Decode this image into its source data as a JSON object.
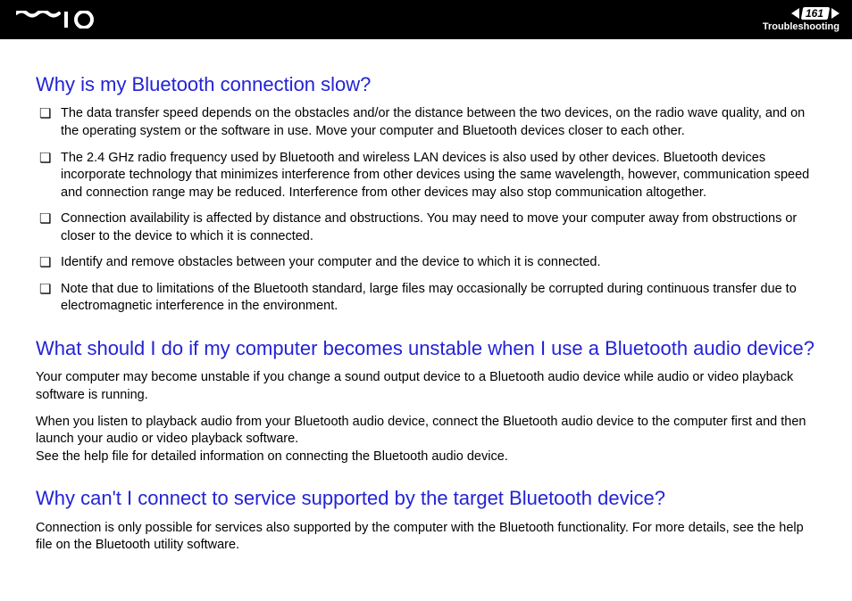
{
  "header": {
    "page_number": "161",
    "section": "Troubleshooting"
  },
  "sections": [
    {
      "heading": "Why is my Bluetooth connection slow?",
      "bullets": [
        "The data transfer speed depends on the obstacles and/or the distance between the two devices, on the radio wave quality, and on the operating system or the software in use. Move your computer and Bluetooth devices closer to each other.",
        "The 2.4 GHz radio frequency used by Bluetooth and wireless LAN devices is also used by other devices. Bluetooth devices incorporate technology that minimizes interference from other devices using the same wavelength, however, communication speed and connection range may be reduced. Interference from other devices may also stop communication altogether.",
        "Connection availability is affected by distance and obstructions. You may need to move your computer away from obstructions or closer to the device to which it is connected.",
        "Identify and remove obstacles between your computer and the device to which it is connected.",
        "Note that due to limitations of the Bluetooth standard, large files may occasionally be corrupted during continuous transfer due to electromagnetic interference in the environment."
      ]
    },
    {
      "heading": "What should I do if my computer becomes unstable when I use a Bluetooth audio device?",
      "paragraphs": [
        "Your computer may become unstable if you change a sound output device to a Bluetooth audio device while audio or video playback software is running.",
        "When you listen to playback audio from your Bluetooth audio device, connect the Bluetooth audio device to the computer first and then launch your audio or video playback software.\nSee the help file for detailed information on connecting the Bluetooth audio device."
      ]
    },
    {
      "heading": "Why can't I connect to service supported by the target Bluetooth device?",
      "paragraphs": [
        "Connection is only possible for services also supported by the computer with the Bluetooth functionality. For more details, see the help file on the Bluetooth utility software."
      ]
    }
  ]
}
